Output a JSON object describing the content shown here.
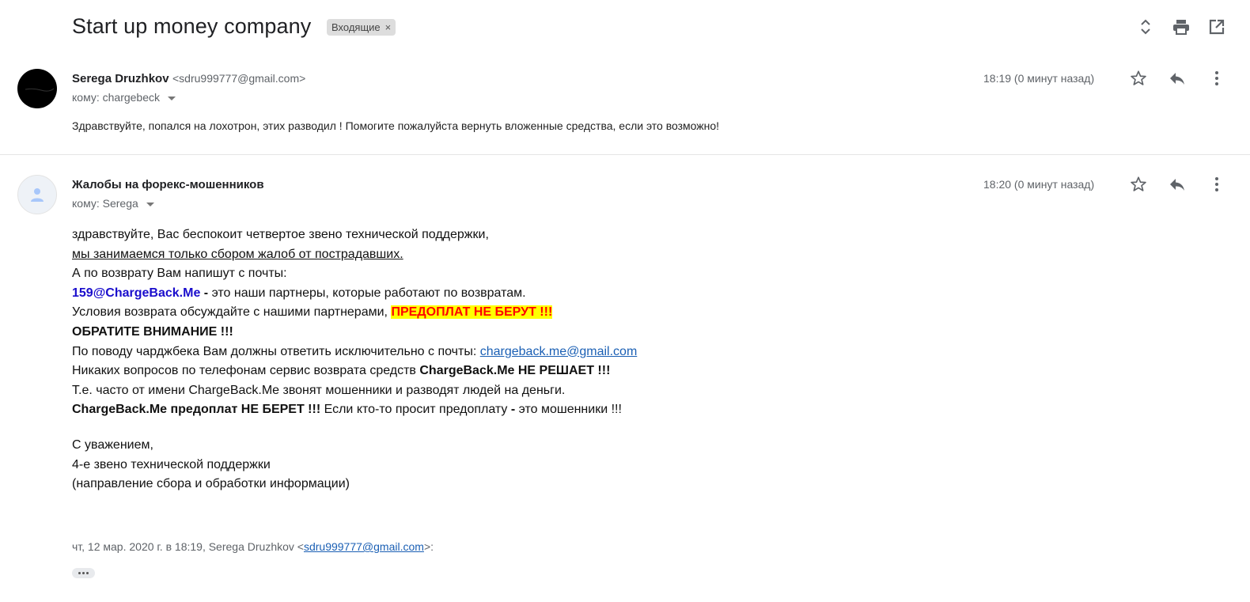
{
  "thread": {
    "subject": "Start up money company",
    "label": "Входящие",
    "label_close": "×",
    "icons": [
      "expand-collapse-icon",
      "print-icon",
      "open-in-new-window-icon"
    ]
  },
  "messages": [
    {
      "sender_name": "Serega Druzhkov",
      "sender_email": "<sdru999777@gmail.com>",
      "to": "кому: chargebeck",
      "time": "18:19 (0 минут назад)",
      "snippet": "Здравствуйте, попался на лохотрон, этих разводил ! Помогите пожалуйста вернуть вложенные средства, если это возможно!"
    },
    {
      "sender_name": "Жалобы на форекс-мошенников",
      "to": "кому: Serega",
      "time": "18:20 (0 минут назад)",
      "body": {
        "l1": "здравствуйте, Вас беспокоит четвертое звено технической поддержки,",
        "l2": "мы занимаемся только сбором жалоб от пострадавших.",
        "l3": "А по возврату Вам напишут с почты:",
        "l4_email": "159@ChargeBack.Me",
        "l4_dash": " - ",
        "l4_rest": "это наши партнеры, которые работают по возвратам.",
        "l5": "Условия возврата обсуждайте с нашими партнерами, ",
        "l5_highlight": "ПРЕДОПЛАТ НЕ БЕРУТ !!!",
        "l6": "ОБРАТИТЕ ВНИМАНИЕ !!!",
        "l7": "По поводу чарджбека Вам должны ответить исключительно с почты: ",
        "l7_link": "chargeback.me@gmail.com",
        "l8": "Никаких вопросов по телефонам сервис возврата средств ",
        "l8_bold": "ChargeBack.Me НЕ РЕШАЕТ !!!",
        "l9": "Т.е. часто от имени ChargeBack.Me звонят мошенники и разводят людей на деньги.",
        "l10_bold": "ChargeBack.Me предоплат НЕ БЕРЕТ !!!",
        "l10_rest": " Если кто-то просит предоплату ",
        "l10_dash": "-",
        "l10_end": " это мошенники !!!",
        "sig1": "С уважением,",
        "sig2": "4-е звено технической поддержки",
        "sig3": "(направление сбора и обработки информации)"
      },
      "quote_header": "чт, 12 мар. 2020 г. в 18:19, Serega Druzhkov <",
      "quote_email": "sdru999777@gmail.com",
      "quote_end": ">:"
    }
  ]
}
